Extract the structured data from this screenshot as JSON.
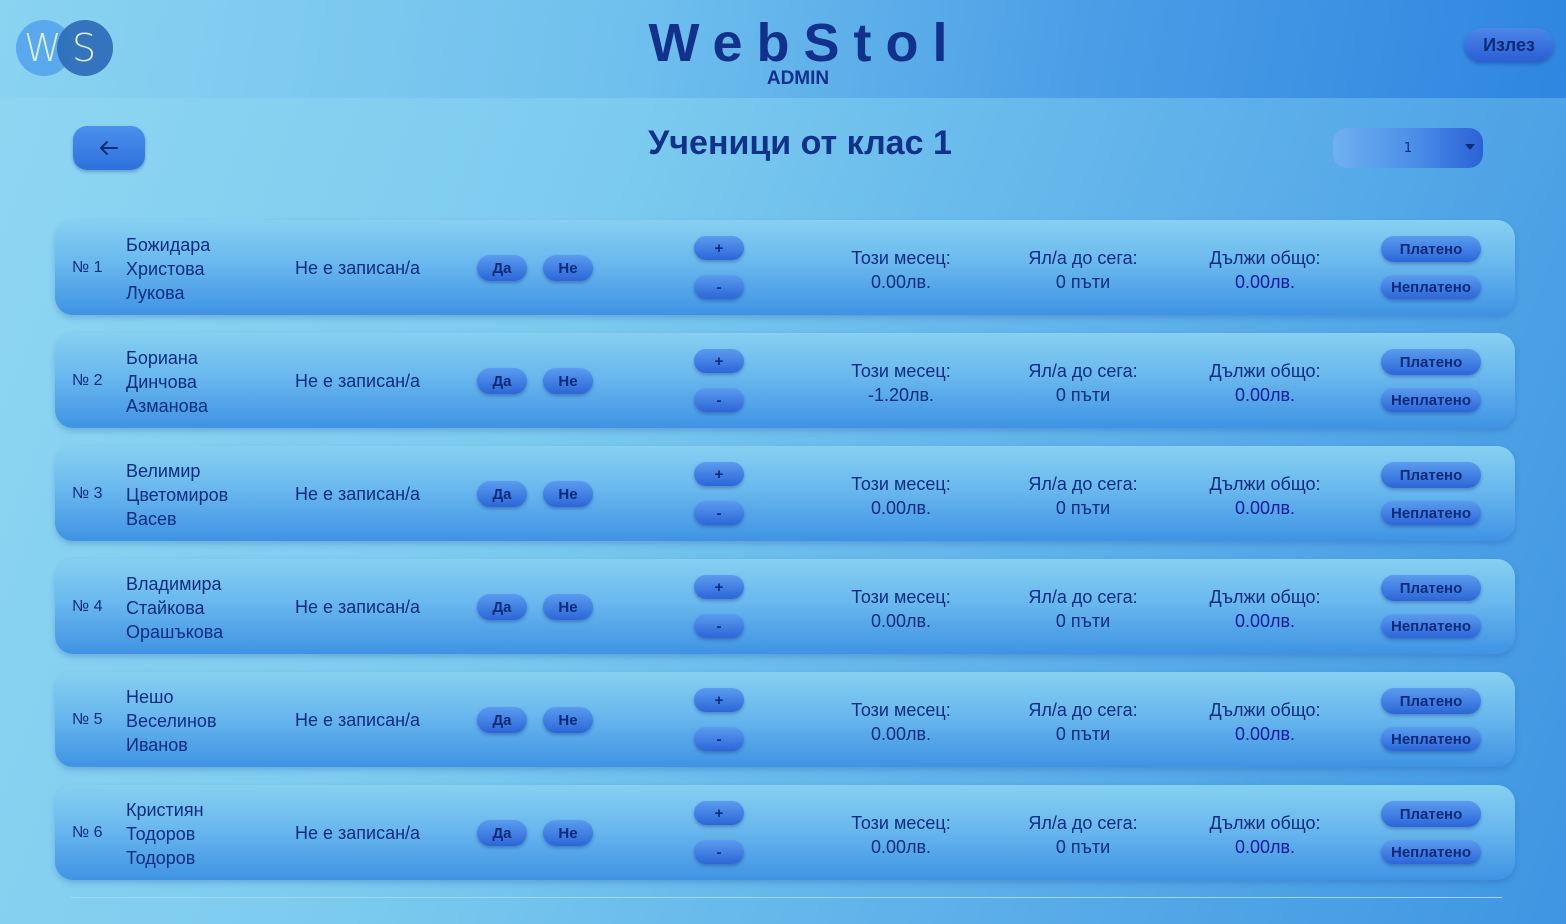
{
  "header": {
    "logo_left": "W",
    "logo_right": "S",
    "app_title": "WebStol",
    "role": "ADMIN",
    "logout_label": "Излез"
  },
  "subheader": {
    "page_title": "Ученици от клас 1",
    "class_selected": "1"
  },
  "labels": {
    "status": "Не е записан/а",
    "yes": "Да",
    "no": "Не",
    "plus": "+",
    "minus": "-",
    "this_month": "Този месец:",
    "eaten_so_far": "Ял/а до сега:",
    "owes_total": "Дължи общо:",
    "paid": "Платено",
    "unpaid": "Неплатено"
  },
  "students": [
    {
      "num": "№ 1",
      "first": "Божидара",
      "middle": "Христова",
      "last": "Лукова",
      "this_month": "0.00лв.",
      "eaten": "0 пъти",
      "owes": "0.00лв."
    },
    {
      "num": "№ 2",
      "first": "Бориана",
      "middle": "Динчова",
      "last": "Азманова",
      "this_month": "-1.20лв.",
      "eaten": "0 пъти",
      "owes": "0.00лв."
    },
    {
      "num": "№ 3",
      "first": "Велимир",
      "middle": "Цветомиров",
      "last": "Васев",
      "this_month": "0.00лв.",
      "eaten": "0 пъти",
      "owes": "0.00лв."
    },
    {
      "num": "№ 4",
      "first": "Владимира",
      "middle": "Стайкова",
      "last": "Орашъкова",
      "this_month": "0.00лв.",
      "eaten": "0 пъти",
      "owes": "0.00лв."
    },
    {
      "num": "№ 5",
      "first": "Нешо",
      "middle": "Веселинов",
      "last": "Иванов",
      "this_month": "0.00лв.",
      "eaten": "0 пъти",
      "owes": "0.00лв."
    },
    {
      "num": "№ 6",
      "first": "Кристиян",
      "middle": "Тодоров",
      "last": "Тодоров",
      "this_month": "0.00лв.",
      "eaten": "0 пъти",
      "owes": "0.00лв."
    }
  ]
}
